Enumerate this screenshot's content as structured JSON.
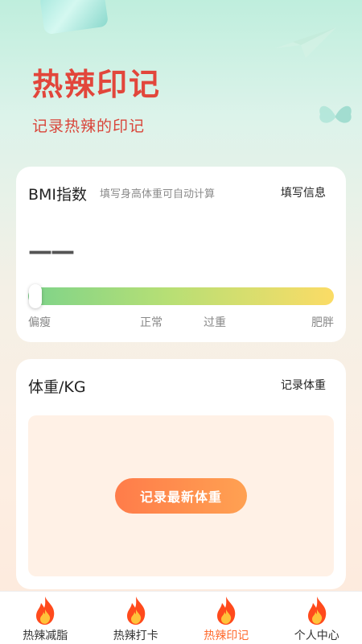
{
  "hero": {
    "title": "热辣印记",
    "subtitle": "记录热辣的印记"
  },
  "bmi_card": {
    "title": "BMI指数",
    "hint": "填写身高体重可自动计算",
    "action_label": "填写信息",
    "value": "——",
    "scale_labels": [
      "偏瘦",
      "正常",
      "过重",
      "肥胖"
    ],
    "gradient_colors": [
      "#7dd38a",
      "#b6df75",
      "#fbdc66"
    ]
  },
  "weight_card": {
    "title": "体重/KG",
    "action_label": "记录体重",
    "record_button": "记录最新体重"
  },
  "tabbar": {
    "items": [
      {
        "label": "热辣减脂",
        "icon": "flame-icon",
        "active": false
      },
      {
        "label": "热辣打卡",
        "icon": "flame-icon",
        "active": false
      },
      {
        "label": "热辣印记",
        "icon": "flame-icon",
        "active": true
      },
      {
        "label": "个人中心",
        "icon": "flame-icon",
        "active": false
      }
    ],
    "active_color": "#ff6a2c"
  },
  "colors": {
    "accent": "#e2463b",
    "button": "#ff7c4a"
  }
}
